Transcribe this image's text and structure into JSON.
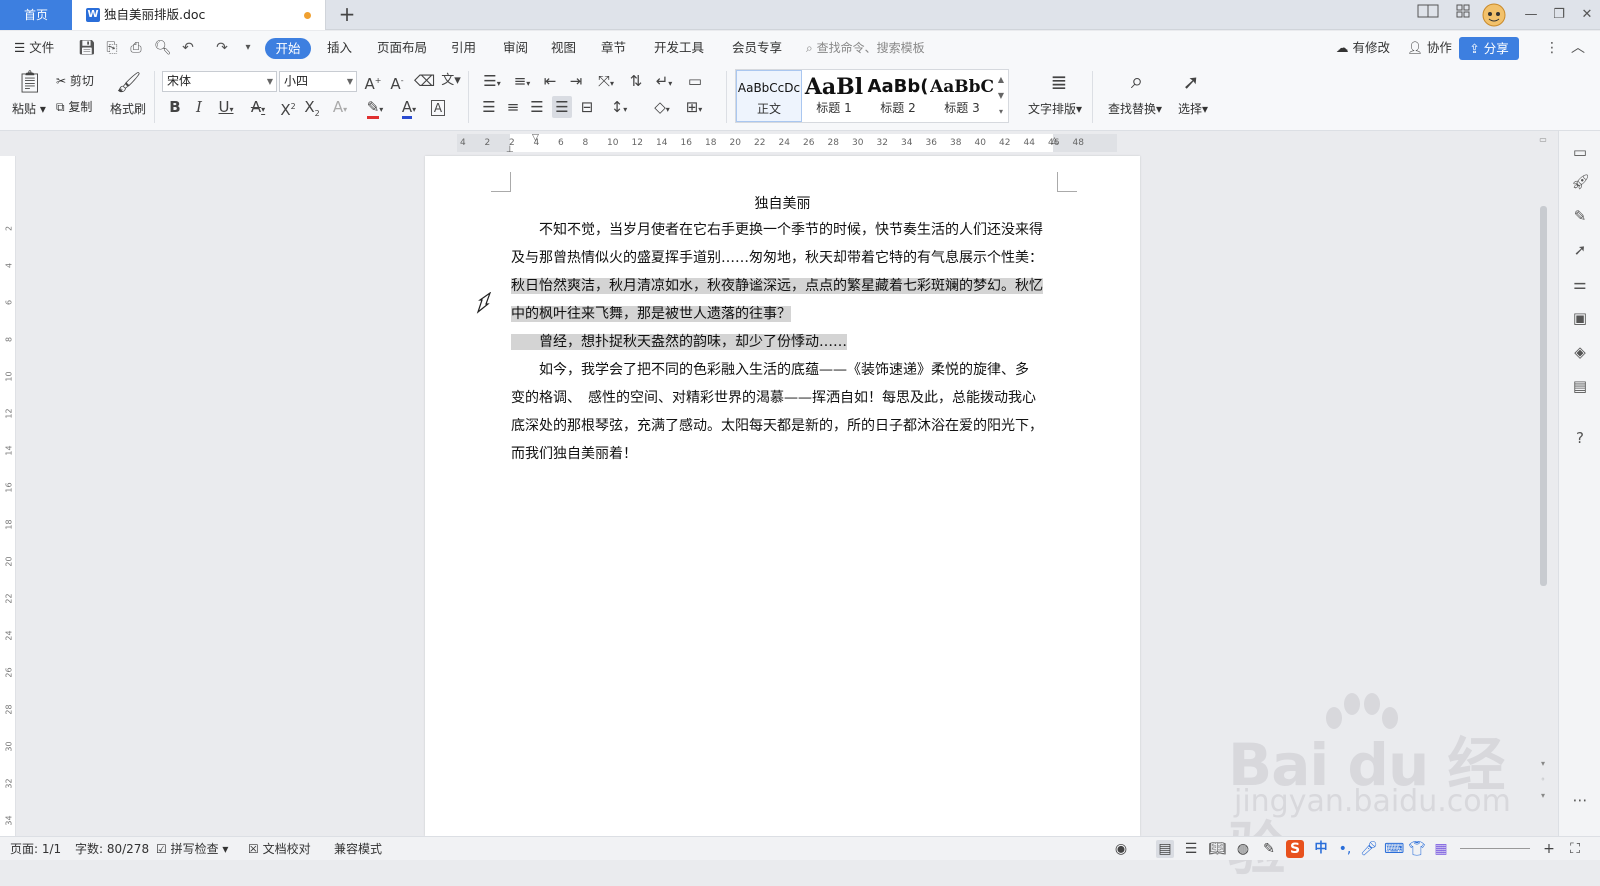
{
  "tabs": {
    "home": "首页",
    "doc_icon_letter": "W",
    "doc_name": "独自美丽排版.doc"
  },
  "menu": {
    "file": "文件",
    "active": "开始",
    "items": [
      "插入",
      "页面布局",
      "引用",
      "审阅",
      "视图",
      "章节",
      "开发工具",
      "会员专享"
    ],
    "search_placeholder": "查找命令、搜索模板",
    "modified": "有修改",
    "collab": "协作",
    "share": "分享"
  },
  "ribbon": {
    "paste": "粘贴",
    "cut": "剪切",
    "copy": "复制",
    "format_painter": "格式刷",
    "font_name": "宋体",
    "font_size": "小四",
    "styles": [
      {
        "preview": "AaBbCcDc",
        "label": "正文"
      },
      {
        "preview": "AaBl",
        "label": "标题 1"
      },
      {
        "preview": "AaBb(",
        "label": "标题 2"
      },
      {
        "preview": "AaBbC",
        "label": "标题 3"
      }
    ],
    "text_layout": "文字排版",
    "find_replace": "查找替换",
    "select": "选择"
  },
  "ruler": {
    "h_ticks": [
      "4",
      "2",
      "2",
      "4",
      "6",
      "8",
      "10",
      "12",
      "14",
      "16",
      "18",
      "20",
      "22",
      "24",
      "26",
      "28",
      "30",
      "32",
      "34",
      "36",
      "38",
      "40",
      "42",
      "44",
      "46",
      "48"
    ],
    "v_ticks": [
      "2",
      "4",
      "6",
      "8",
      "10",
      "12",
      "14",
      "16",
      "18",
      "20",
      "22",
      "24",
      "26",
      "28",
      "30",
      "32",
      "34"
    ]
  },
  "document": {
    "title": "独自美丽",
    "lines": [
      {
        "text": "　　不知不觉，当岁月使者在它右手更换一个季节的时候，快节奏生活的人们还没来得",
        "hl": false
      },
      {
        "text": "及与那曾热情似火的盛夏挥手道别……匆匆地，秋天却带着它特的有气息展示个性美：",
        "hl": false
      },
      {
        "text": "秋日怡然爽洁，秋月清凉如水，秋夜静谧深远，点点的繁星藏着七彩斑斓的梦幻。秋忆",
        "hl": true
      },
      {
        "text": "中的枫叶往来飞舞，那是被世人遗落的往事？",
        "hl": true
      },
      {
        "text": "　　曾经，想扑捉秋天盎然的韵味，却少了份悸动……",
        "hl": true
      },
      {
        "text": "　　如今，我学会了把不同的色彩融入生活的底蕴——《装饰速递》柔悦的旋律、多",
        "hl": false
      },
      {
        "text": "变的格调、　感性的空间、对精彩世界的渴慕——挥洒自如！每思及此，总能拨动我心",
        "hl": false
      },
      {
        "text": "底深处的那根琴弦，充满了感动。太阳每天都是新的，所的日子都沐浴在爱的阳光下，",
        "hl": false
      },
      {
        "text": "而我们独自美丽着！",
        "hl": false
      }
    ]
  },
  "status": {
    "page": "页面: 1/1",
    "words": "字数: 80/278",
    "spell": "拼写检查",
    "proof": "文档校对",
    "compat": "兼容模式"
  },
  "watermark": {
    "main": "Bai du 经验",
    "sub": "jingyan.baidu.com"
  },
  "colors": {
    "accent": "#3d7fe0",
    "highlight": "#d4d4d4",
    "unsaved_dot": "#f0a030"
  }
}
